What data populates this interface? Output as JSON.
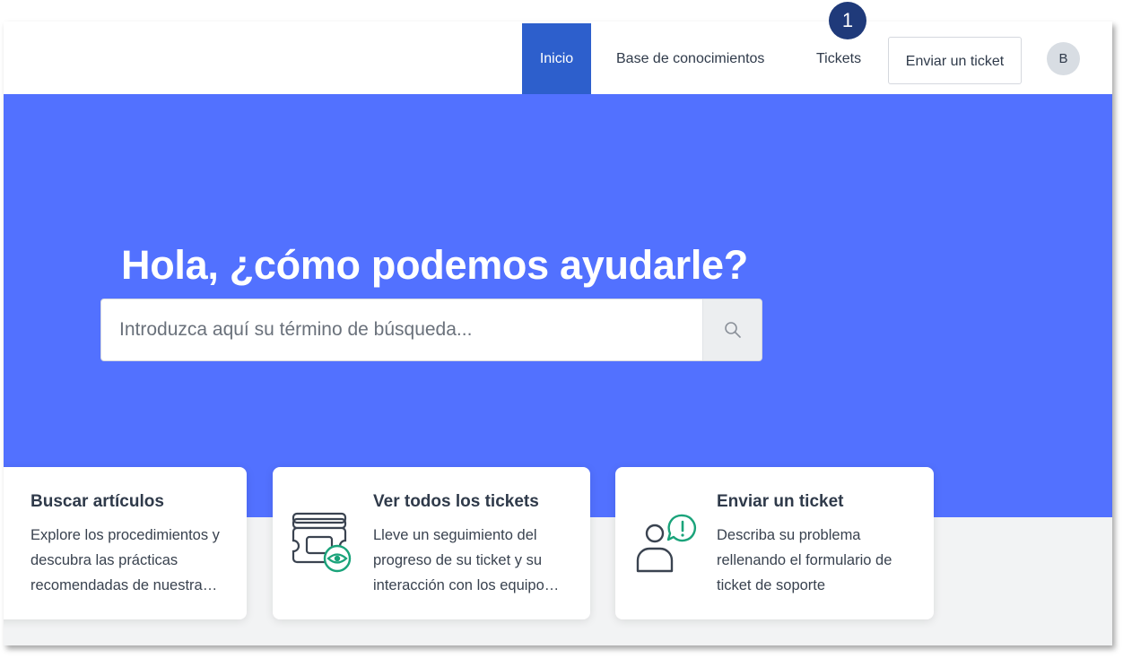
{
  "nav": {
    "home": "Inicio",
    "knowledge_base": "Base de conocimientos",
    "tickets": "Tickets",
    "submit_ticket": "Enviar un ticket",
    "avatar_initial": "B"
  },
  "step_badge": "1",
  "hero": {
    "title": "Hola, ¿cómo podemos ayudarle?",
    "search_placeholder": "Introduzca aquí su término de búsqueda..."
  },
  "cards": [
    {
      "title": "Buscar artículos",
      "lines": [
        "Explore los procedimientos y",
        "descubra las prácticas",
        "recomendadas de nuestra…"
      ]
    },
    {
      "title": "Ver todos los tickets",
      "lines": [
        "Lleve un seguimiento del",
        "progreso de su ticket y su",
        "interacción con los equipo…"
      ],
      "icon": "ticket-view-icon"
    },
    {
      "title": "Enviar un ticket",
      "lines": [
        "Describa su problema",
        "rellenando el formulario de",
        "ticket de soporte"
      ],
      "icon": "user-alert-icon"
    }
  ],
  "colors": {
    "hero_bg": "#5271ff",
    "nav_active": "#2d5fcc",
    "badge": "#1f3a7a",
    "icon_accent": "#1aa37a",
    "icon_stroke": "#3a4350"
  }
}
